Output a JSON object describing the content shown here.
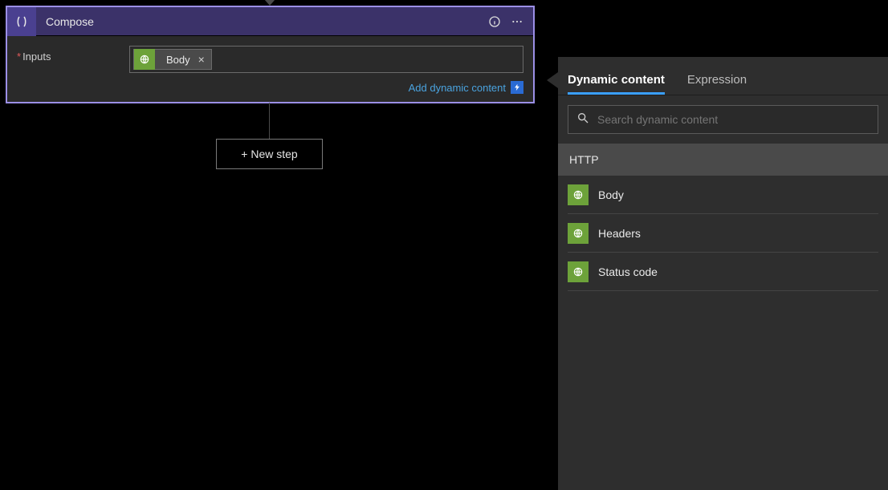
{
  "compose": {
    "title": "Compose",
    "inputs_label": "Inputs",
    "token_label": "Body",
    "add_dynamic_label": "Add dynamic content"
  },
  "new_step_label": "+ New step",
  "dynamic_panel": {
    "tabs": {
      "dynamic": "Dynamic content",
      "expression": "Expression"
    },
    "search_placeholder": "Search dynamic content",
    "section_title": "HTTP",
    "items": [
      {
        "label": "Body"
      },
      {
        "label": "Headers"
      },
      {
        "label": "Status code"
      }
    ]
  },
  "colors": {
    "accent_blue": "#3aa0ff",
    "http_green": "#6da23a"
  }
}
